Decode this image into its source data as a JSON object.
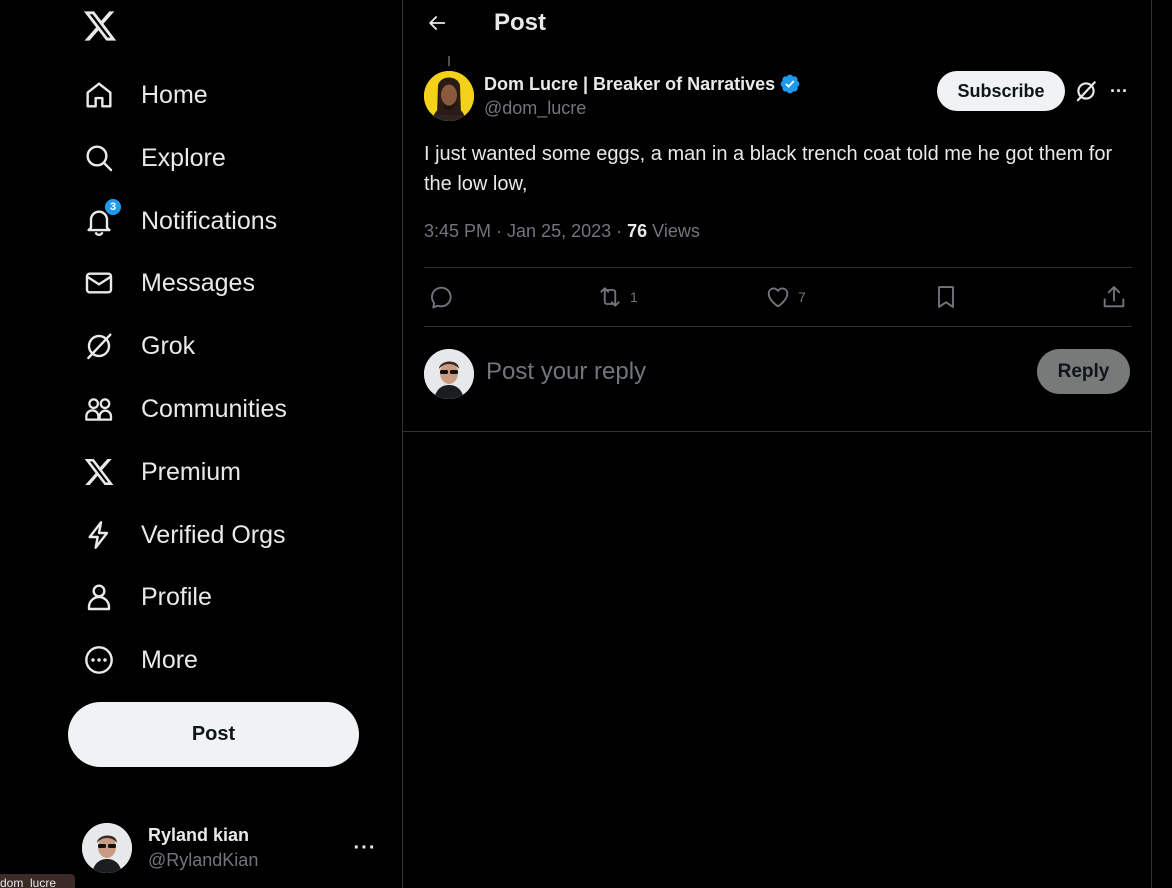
{
  "nav": {
    "items": [
      {
        "label": "Home",
        "icon": "home-icon"
      },
      {
        "label": "Explore",
        "icon": "search-icon"
      },
      {
        "label": "Notifications",
        "icon": "bell-icon",
        "badge": "3"
      },
      {
        "label": "Messages",
        "icon": "envelope-icon"
      },
      {
        "label": "Grok",
        "icon": "grok-icon"
      },
      {
        "label": "Communities",
        "icon": "people-icon"
      },
      {
        "label": "Premium",
        "icon": "x-logo-icon"
      },
      {
        "label": "Verified Orgs",
        "icon": "lightning-icon"
      },
      {
        "label": "Profile",
        "icon": "person-icon"
      },
      {
        "label": "More",
        "icon": "more-circle-icon"
      }
    ],
    "post_label": "Post"
  },
  "account": {
    "name": "Ryland kian",
    "handle": "@RylandKian",
    "more": "···"
  },
  "status_tooltip": "dom_lucre",
  "header": {
    "title": "Post"
  },
  "tweet": {
    "author_name": "Dom Lucre | Breaker of Narratives",
    "author_handle": "@dom_lucre",
    "subscribe_label": "Subscribe",
    "more": "···",
    "text": "I just wanted some eggs, a man in a black trench coat told me he got them for the low low,",
    "time": "3:45 PM · Jan 25, 2023 · ",
    "views_count": "76",
    "views_label": " Views",
    "retweet_count": "1",
    "like_count": "7"
  },
  "reply": {
    "placeholder": "Post your reply",
    "button_label": "Reply"
  },
  "colors": {
    "background": "#000000",
    "text": "#e7e9ea",
    "muted": "#71767b",
    "accent": "#1d9bf0",
    "border": "#2f3336"
  }
}
